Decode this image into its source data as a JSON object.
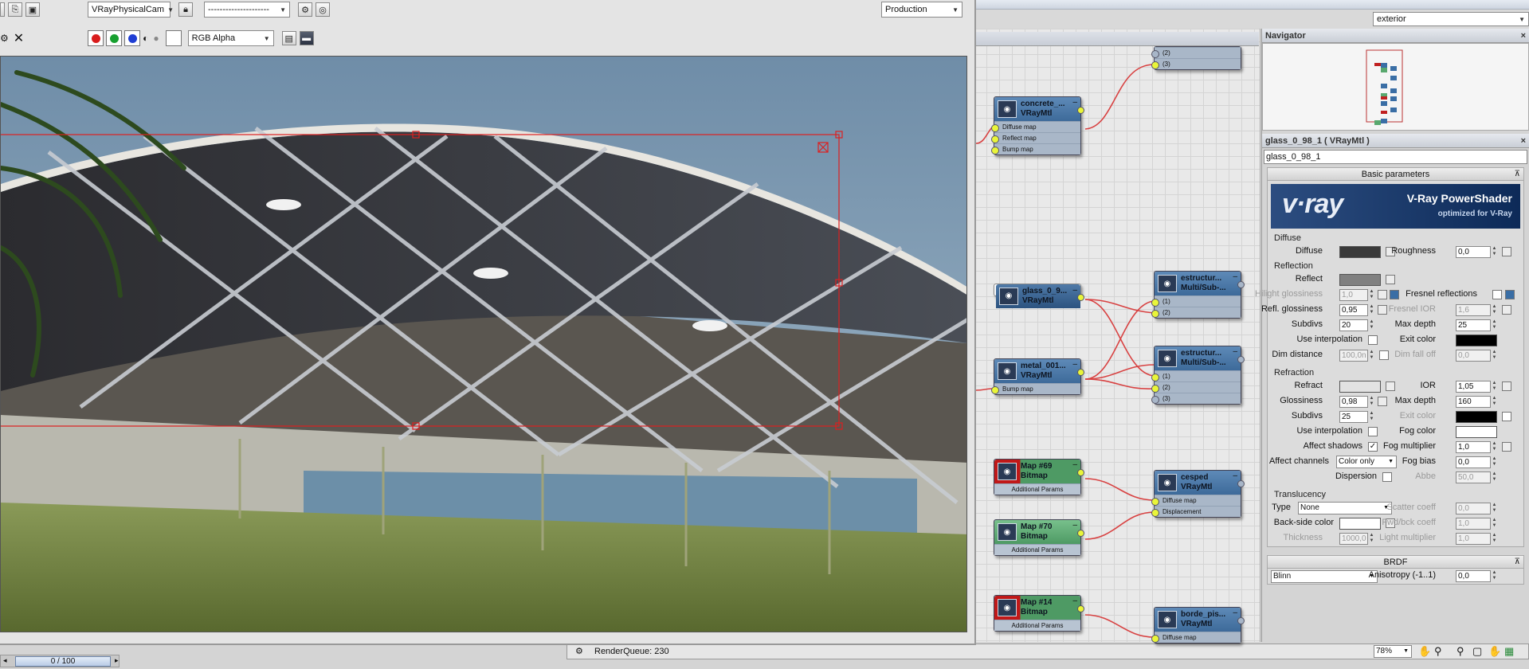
{
  "render_frame": {
    "camera_select": "VRayPhysicalCam",
    "preset_select": "---------------------",
    "mode_select": "Production",
    "channel_select": "RGB Alpha"
  },
  "top_right": {
    "view_select": "exterior"
  },
  "navigator": {
    "title": "Navigator"
  },
  "slate": {
    "nodes": [
      {
        "id": "n-top",
        "title": "",
        "subtitle": "",
        "slots": [
          "(2)",
          "(3)"
        ]
      },
      {
        "id": "n-concrete",
        "title": "concrete_...",
        "subtitle": "VRayMtl",
        "slots": [
          "Diffuse map",
          "Reflect map",
          "Bump map"
        ]
      },
      {
        "id": "n-glass",
        "title": "glass_0_9...",
        "subtitle": "VRayMtl",
        "slots": []
      },
      {
        "id": "n-metal",
        "title": "metal_001...",
        "subtitle": "VRayMtl",
        "slots": [
          "Bump map"
        ]
      },
      {
        "id": "n-estr1",
        "title": "estructur...",
        "subtitle": "Multi/Sub-...",
        "slots": [
          "(1)",
          "(2)"
        ]
      },
      {
        "id": "n-estr2",
        "title": "estructur...",
        "subtitle": "Multi/Sub-...",
        "slots": [
          "(1)",
          "(2)",
          "(3)"
        ]
      },
      {
        "id": "n-map69",
        "title": "Map #69",
        "subtitle": "Bitmap",
        "slots": [
          "Additional Params"
        ]
      },
      {
        "id": "n-map70",
        "title": "Map #70",
        "subtitle": "Bitmap",
        "slots": [
          "Additional Params"
        ]
      },
      {
        "id": "n-cesped",
        "title": "cesped",
        "subtitle": "VRayMtl",
        "slots": [
          "Diffuse map",
          "Displacement"
        ]
      },
      {
        "id": "n-map14",
        "title": "Map #14",
        "subtitle": "Bitmap",
        "slots": [
          "Additional Params"
        ]
      },
      {
        "id": "n-borde",
        "title": "borde_pis...",
        "subtitle": "VRayMtl",
        "slots": [
          "Diffuse map"
        ]
      }
    ]
  },
  "material": {
    "title": "glass_0_98_1  ( VRayMtl )",
    "name": "glass_0_98_1",
    "rollout_basic": "Basic parameters",
    "banner_logo": "v·ray",
    "banner_title": "V-Ray PowerShader",
    "banner_sub": "optimized for V-Ray",
    "diffuse_group": "Diffuse",
    "diffuse_label": "Diffuse",
    "roughness_label": "Roughness",
    "roughness": "0,0",
    "reflection_group": "Reflection",
    "reflect_label": "Reflect",
    "hilight_label": "Hilight glossiness",
    "hilight": "1,0",
    "fresnel_label": "Fresnel reflections",
    "refl_gloss_label": "Refl. glossiness",
    "refl_gloss": "0,95",
    "fresnel_ior_label": "Fresnel IOR",
    "fresnel_ior": "1,6",
    "subdivs_label": "Subdivs",
    "subdivs": "20",
    "maxdepth_label": "Max depth",
    "maxdepth": "25",
    "use_interp_label": "Use interpolation",
    "exit_color_label": "Exit color",
    "dim_dist_label": "Dim distance",
    "dim_dist": "100,0n",
    "dim_falloff_label": "Dim fall off",
    "dim_falloff": "0,0",
    "refraction_group": "Refraction",
    "refract_label": "Refract",
    "ior_label": "IOR",
    "ior": "1,05",
    "glossiness_label": "Glossiness",
    "glossiness": "0,98",
    "r_maxdepth_label": "Max depth",
    "r_maxdepth": "160",
    "r_subdivs_label": "Subdivs",
    "r_subdivs": "25",
    "r_exit_label": "Exit color",
    "r_use_interp_label": "Use interpolation",
    "fog_color_label": "Fog color",
    "affect_shadows_label": "Affect shadows",
    "fog_mult_label": "Fog multiplier",
    "fog_mult": "1,0",
    "affect_channels_label": "Affect channels",
    "affect_channels": "Color only",
    "fog_bias_label": "Fog bias",
    "fog_bias": "0,0",
    "dispersion_label": "Dispersion",
    "abbe_label": "Abbe",
    "abbe": "50,0",
    "translucency_group": "Translucency",
    "type_label": "Type",
    "type_value": "None",
    "scatter_label": "Scatter coeff",
    "scatter": "0,0",
    "backside_label": "Back-side color",
    "fwd_label": "Fwd/bck coeff",
    "fwd": "1,0",
    "thickness_label": "Thickness",
    "thickness": "1000,0",
    "light_mult_label": "Light multiplier",
    "light_mult": "1,0",
    "rollout_brdf": "BRDF",
    "brdf_type": "Blinn",
    "anisotropy_label": "Anisotropy (-1..1)",
    "anisotropy": "0,0"
  },
  "status": {
    "render_queue": "RenderQueue: 230",
    "time_slider": "0 / 100",
    "zoom": "78%"
  },
  "colors": {
    "diffuse": "#3a3a3a",
    "reflect": "#808080",
    "refract": "#e2e2e2",
    "exit": "#000000",
    "fog": "#ffffff"
  }
}
